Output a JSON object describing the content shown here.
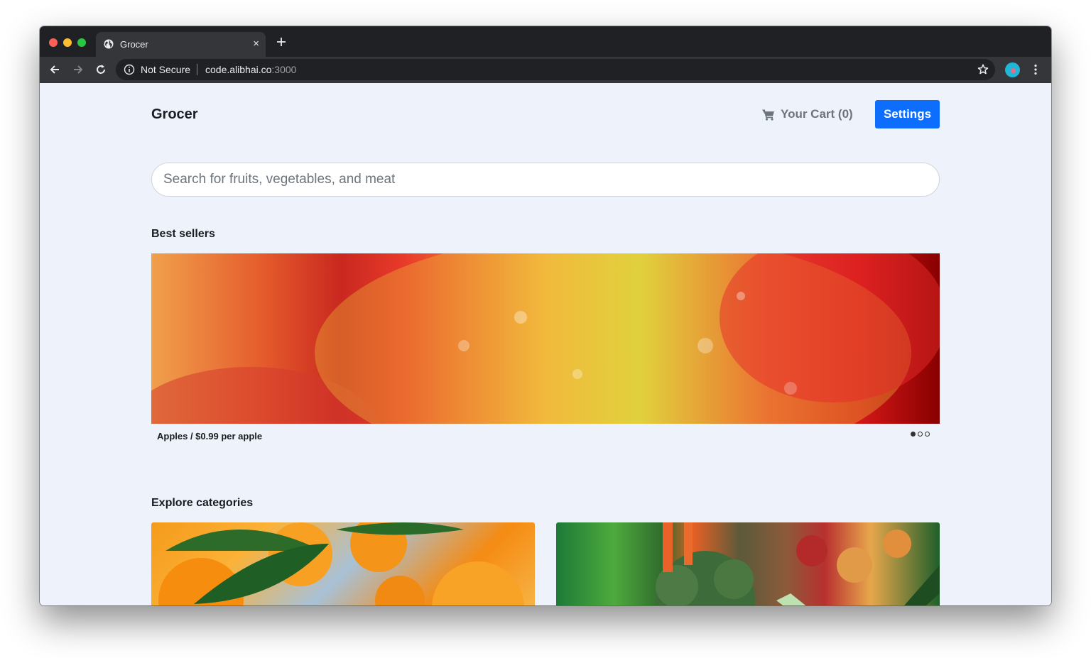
{
  "browser": {
    "tab_title": "Grocer",
    "tab_close": "×",
    "security_label": "Not Secure",
    "url_host": "code.alibhai.co",
    "url_port": ":3000"
  },
  "header": {
    "brand": "Grocer",
    "cart_label": "Your Cart (0)",
    "settings_label": "Settings"
  },
  "search": {
    "placeholder": "Search for fruits, vegetables, and meat"
  },
  "best_sellers": {
    "title": "Best sellers",
    "caption": "Apples / $0.99 per apple",
    "slide_count": 3,
    "active_slide": 1
  },
  "categories": {
    "title": "Explore categories"
  },
  "colors": {
    "accent": "#0d6efd",
    "page_background": "#eef2fa",
    "browser_chrome": "#202124"
  }
}
